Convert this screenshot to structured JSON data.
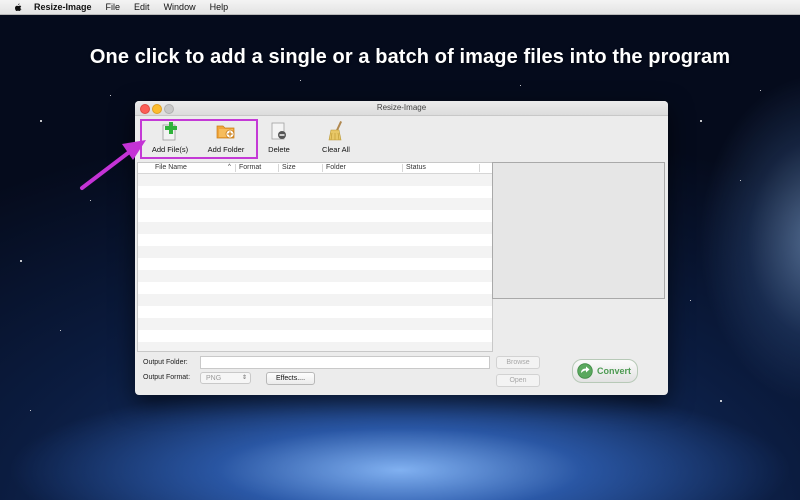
{
  "menubar": {
    "app_name": "Resize-Image",
    "items": [
      "File",
      "Edit",
      "Window",
      "Help"
    ]
  },
  "headline": "One click to add a single or a batch of image files into the program",
  "window": {
    "title": "Resize-Image",
    "toolbar": {
      "add_files": "Add File(s)",
      "add_folder": "Add Folder",
      "delete": "Delete",
      "clear_all": "Clear All"
    },
    "table": {
      "columns": [
        "File Name",
        "Format",
        "Size",
        "Folder",
        "Status"
      ],
      "sort_indicator": "^",
      "rows": []
    },
    "output_folder_label": "Output Folder:",
    "output_folder_value": "",
    "browse": "Browse",
    "open": "Open",
    "output_format_label": "Output Format:",
    "output_format_value": "PNG",
    "effects": "Effects....",
    "convert": "Convert"
  },
  "colors": {
    "highlight": "#c43ad6",
    "arrow": "#c433d6",
    "convert_text": "#4d9a52"
  }
}
